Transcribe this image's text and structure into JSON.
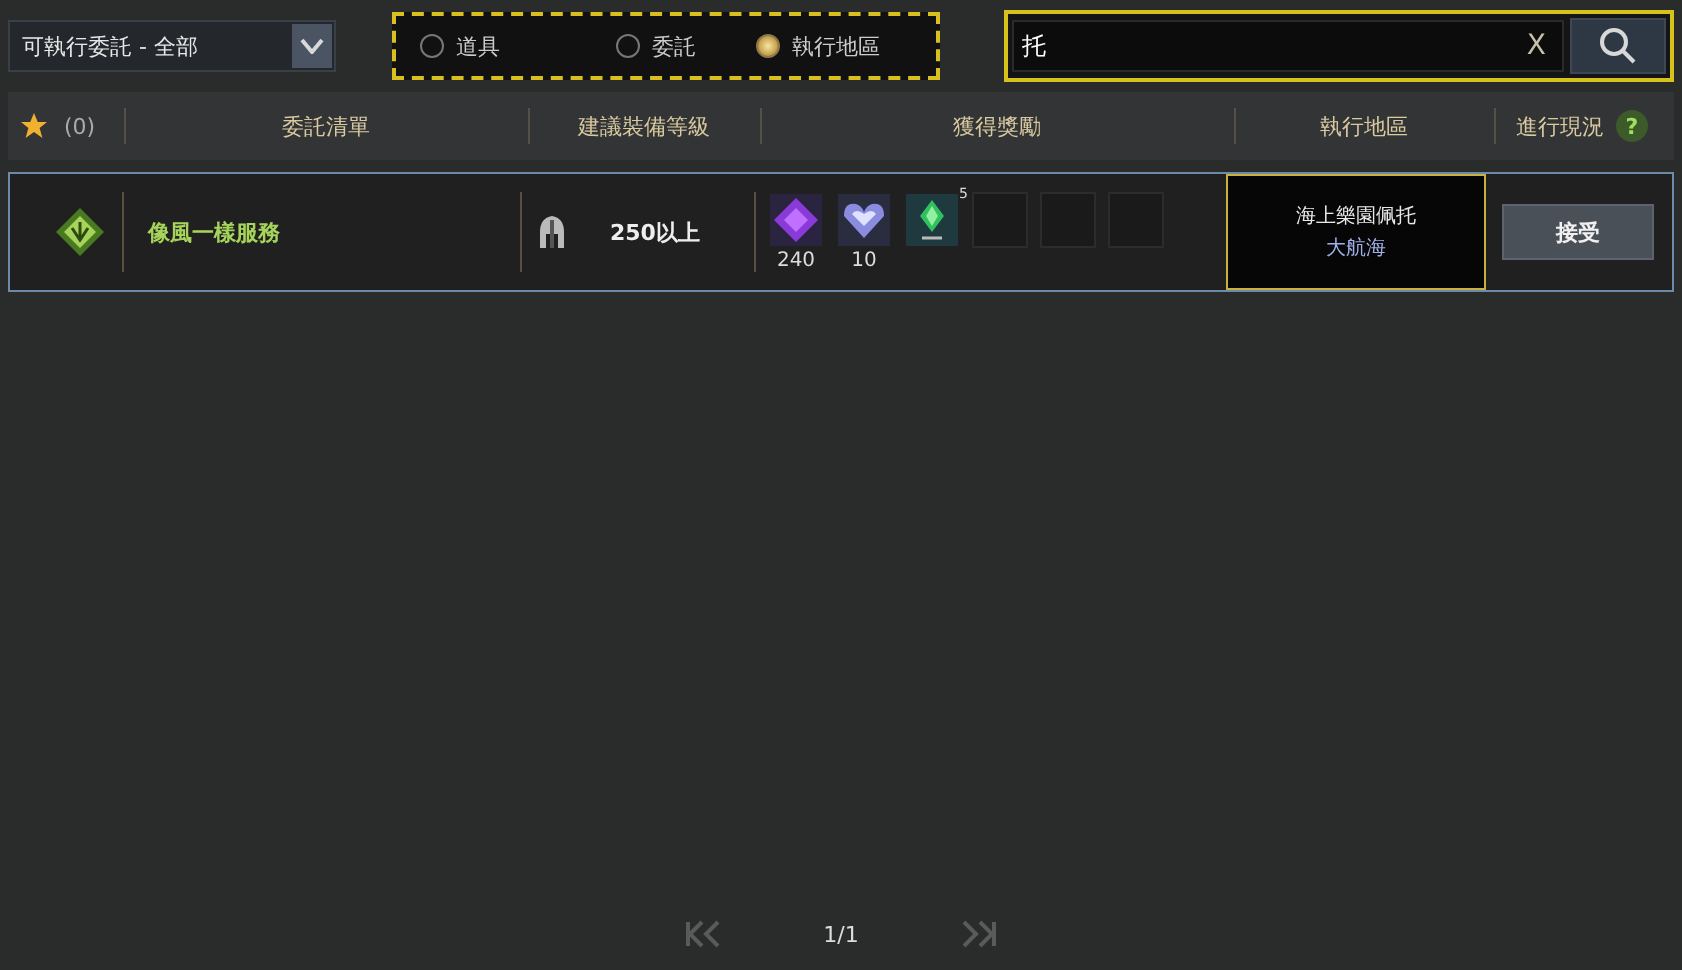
{
  "filter_dropdown": {
    "value": "可執行委託 - 全部"
  },
  "search_type": [
    {
      "label": "道具",
      "selected": false
    },
    {
      "label": "委託",
      "selected": false
    },
    {
      "label": "執行地區",
      "selected": true
    }
  ],
  "search": {
    "value": "托",
    "clear": "X"
  },
  "header": {
    "favorites_count": "(0)",
    "columns": [
      "委託清單",
      "建議裝備等級",
      "獲得獎勵",
      "執行地區",
      "進行現況"
    ],
    "help": "?"
  },
  "rows": [
    {
      "name": "像風一樣服務",
      "level": "250以上",
      "rewards": [
        {
          "kind": "purple-gem",
          "count": "240"
        },
        {
          "kind": "heart-gem",
          "count": "10"
        },
        {
          "kind": "green-crystal",
          "badge": "5"
        },
        {
          "kind": "empty"
        },
        {
          "kind": "empty"
        },
        {
          "kind": "empty"
        }
      ],
      "location": "海上樂園佩托",
      "region": "大航海",
      "action": "接受",
      "selected": true
    }
  ],
  "pager": {
    "page": "1/1"
  }
}
